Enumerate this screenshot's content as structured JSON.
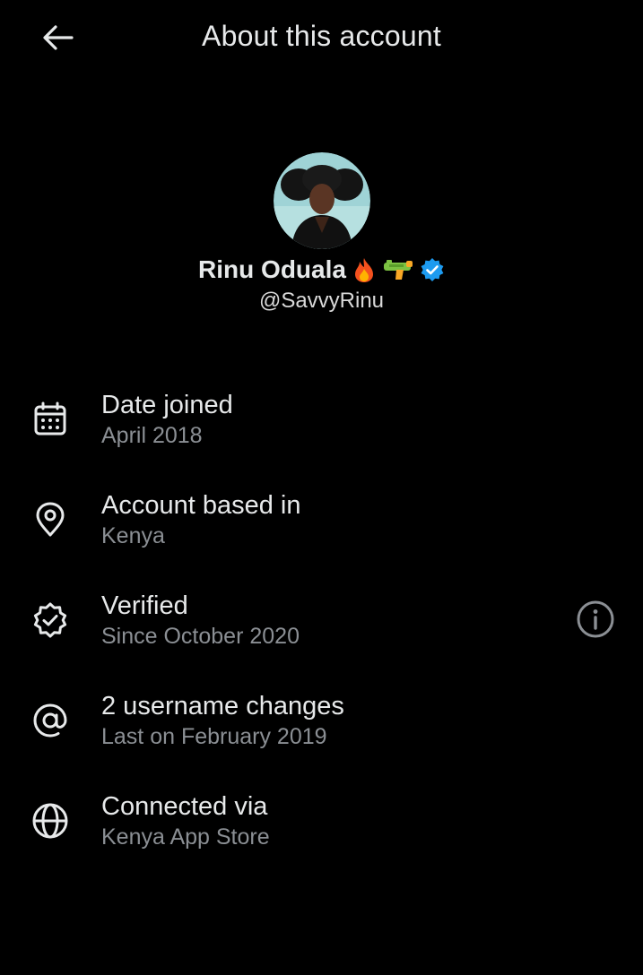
{
  "header": {
    "title": "About this account"
  },
  "profile": {
    "name": "Rinu Oduala",
    "handle": "@SavvyRinu",
    "badge_color": "#1d9bf0"
  },
  "rows": [
    {
      "icon": "calendar-icon",
      "label": "Date joined",
      "sub": "April 2018"
    },
    {
      "icon": "location-pin-icon",
      "label": "Account based in",
      "sub": "Kenya"
    },
    {
      "icon": "verified-badge-icon",
      "label": "Verified",
      "sub": "Since October 2020"
    },
    {
      "icon": "at-sign-icon",
      "label": "2 username changes",
      "sub": "Last on February 2019"
    },
    {
      "icon": "globe-icon",
      "label": "Connected via",
      "sub": "Kenya App Store"
    }
  ],
  "colors": {
    "background": "#000000",
    "primary_text": "#e7e9ea",
    "secondary_text": "#8b8f94"
  }
}
